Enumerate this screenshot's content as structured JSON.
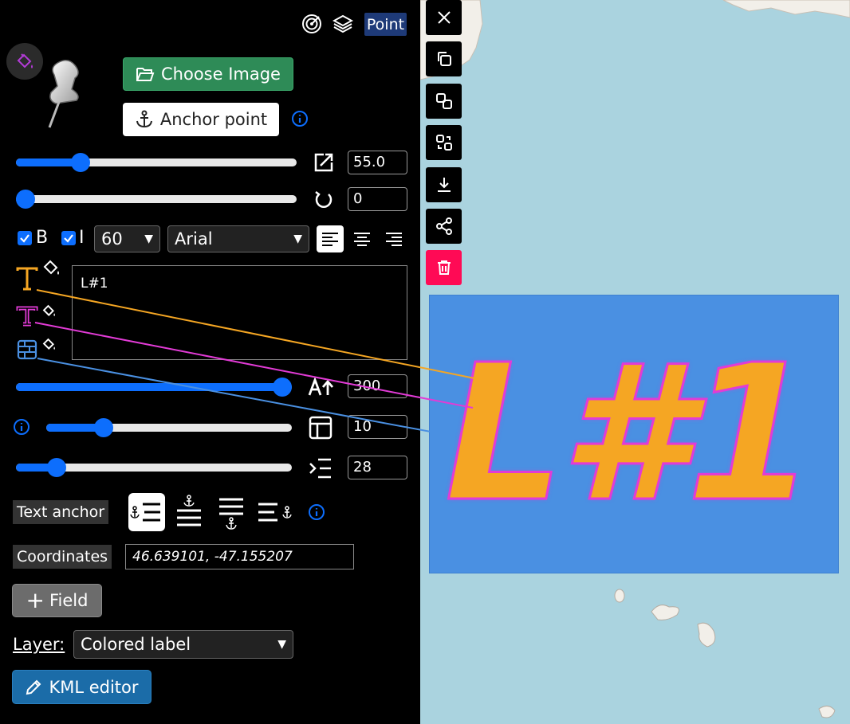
{
  "header": {
    "geometry_badge": "Point",
    "icons": [
      "radar-icon",
      "layers-icon"
    ]
  },
  "image_controls": {
    "choose_image_label": "Choose Image",
    "anchor_point_label": "Anchor point"
  },
  "scale": {
    "value": "55.0",
    "slider_fraction": 0.21
  },
  "rotation": {
    "value": "0",
    "slider_fraction": 0.0
  },
  "font": {
    "bold_label": "B",
    "italic_label": "I",
    "bold_checked": true,
    "italic_checked": true,
    "size": "60",
    "family": "Arial",
    "alignment": "left"
  },
  "label_text": "L#1",
  "colors": {
    "text_color": "#f5a623",
    "outline_color": "#e23bd6",
    "background_color": "#4a90e2",
    "accent": "#0d6efd",
    "delete": "#ff0a55"
  },
  "max_width": {
    "value": "300",
    "slider_fraction": 1.0
  },
  "padding": {
    "value": "10",
    "slider_fraction": 0.21
  },
  "line_height": {
    "value": "28",
    "slider_fraction": 0.12
  },
  "text_anchor": {
    "label": "Text anchor",
    "options": [
      "left",
      "top",
      "bottom",
      "right"
    ],
    "selected": "left"
  },
  "coordinates": {
    "label": "Coordinates",
    "value": "46.639101, -47.155207"
  },
  "field_button_label": "Field",
  "layer": {
    "label": "Layer:",
    "value": "Colored label"
  },
  "kml_editor_label": "KML editor",
  "map_label": {
    "text": "L#1"
  },
  "toolbar": [
    "close-icon",
    "copy-icon",
    "duplicate-icon",
    "move-icon",
    "download-icon",
    "share-icon",
    "trash-icon"
  ]
}
